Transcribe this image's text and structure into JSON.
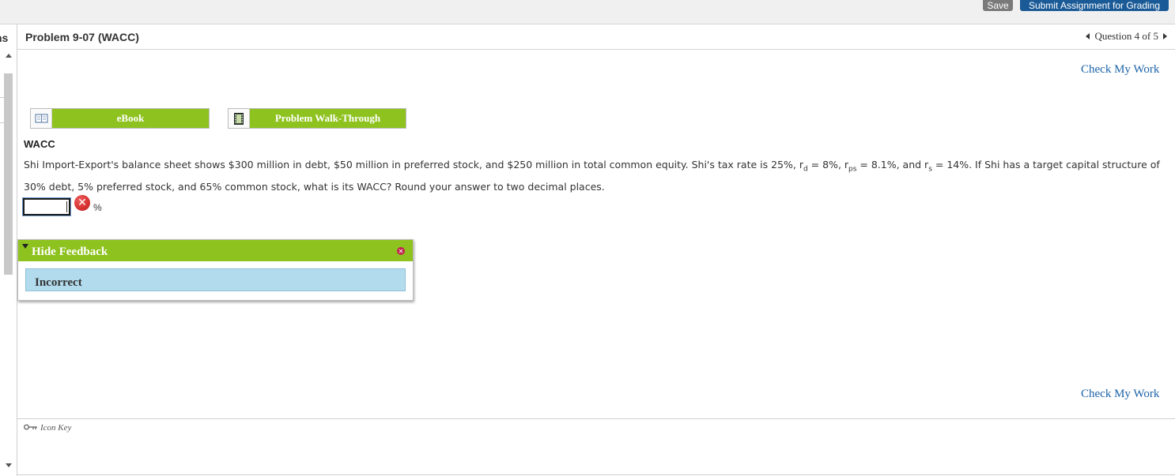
{
  "toolbar": {
    "save_label": "Save",
    "submit_label": "Submit Assignment for Grading"
  },
  "sidebar": {
    "fragment_text": "ns"
  },
  "header": {
    "problem_title": "Problem 9-07 (WACC)",
    "question_nav": "Question 4 of 5"
  },
  "actions": {
    "check_my_work": "Check My Work"
  },
  "resources": {
    "ebook_label": "eBook",
    "walkthrough_label": "Problem Walk-Through"
  },
  "question": {
    "heading": "WACC",
    "text_before_rd": "Shi Import-Export's balance sheet shows $300 million in debt, $50 million in preferred stock, and $250 million in total common equity. Shi's tax rate is 25%, r",
    "sub_d": "d",
    "text_rd_value": " = 8%, r",
    "sub_ps": "ps",
    "text_rps_value": " = 8.1%, and r",
    "sub_s": "s",
    "text_after": " = 14%. If Shi has a target capital structure of 30% debt, 5% preferred stock, and 65% common stock, what is its WACC? Round your answer to two decimal places.",
    "answer_value": "",
    "unit": "%"
  },
  "feedback": {
    "toggle_label": "Hide Feedback",
    "result": "Incorrect"
  },
  "footer": {
    "icon_key_label": "Icon Key"
  },
  "colors": {
    "accent_green": "#8ec21f",
    "link_blue": "#1c63a8",
    "submit_blue": "#1a5a96",
    "feedback_bg": "#b2dcee",
    "error_red": "#c41717"
  },
  "icons": [
    "book-icon",
    "film-icon",
    "incorrect-icon",
    "close-icon",
    "key-icon"
  ]
}
